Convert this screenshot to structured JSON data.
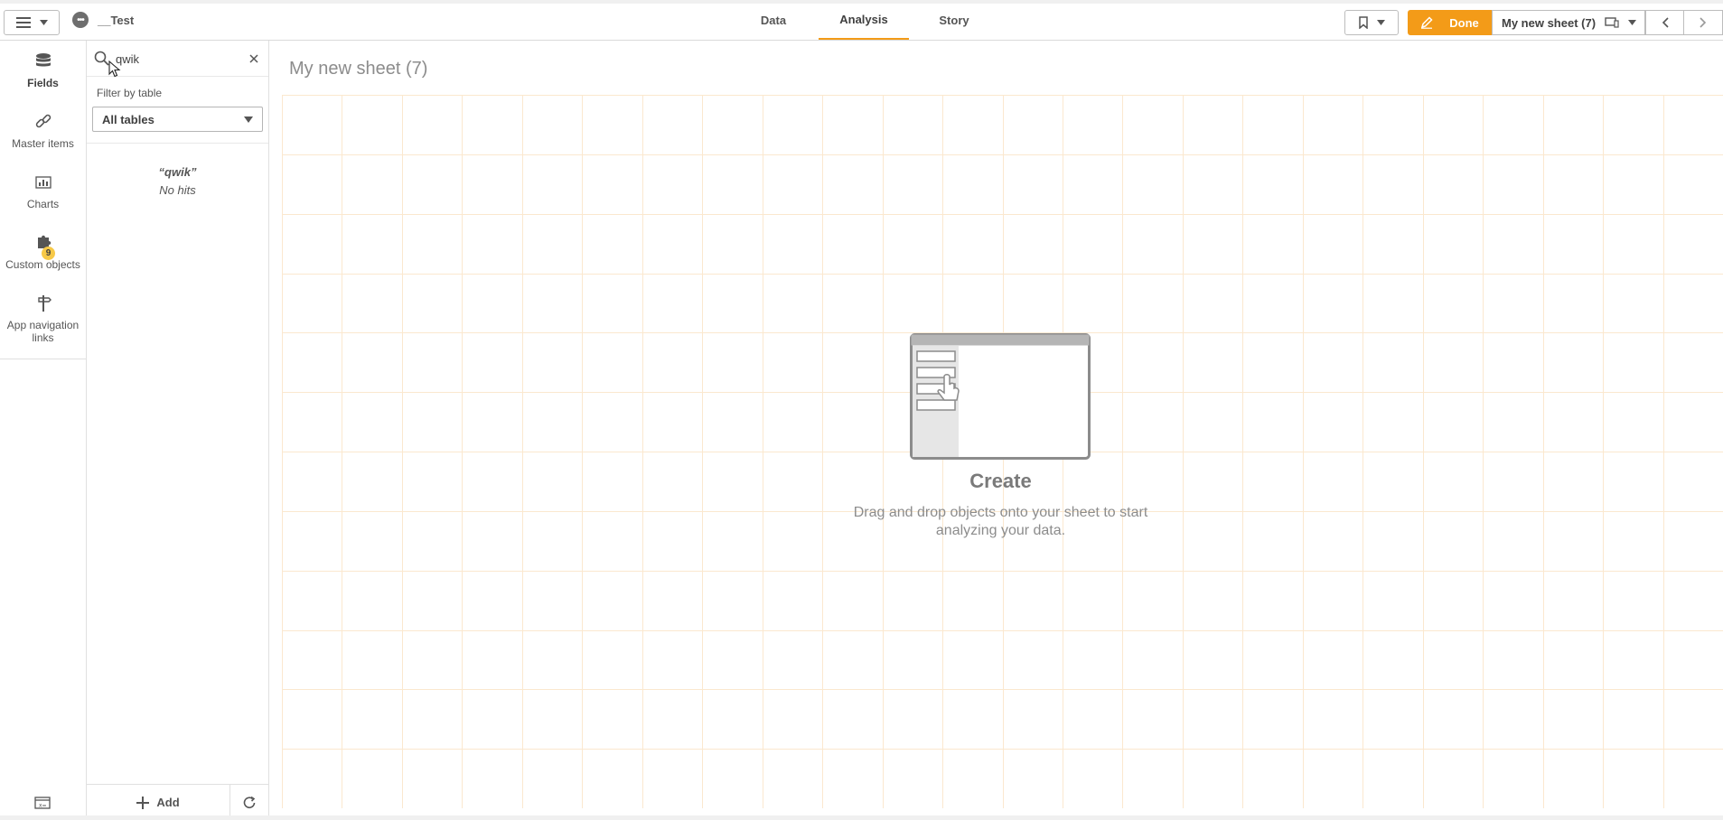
{
  "app": {
    "name": "__Test"
  },
  "tabs": [
    {
      "label": "Data",
      "active": false
    },
    {
      "label": "Analysis",
      "active": true
    },
    {
      "label": "Story",
      "active": false
    }
  ],
  "toolbar": {
    "done_label": "Done",
    "sheet_name": "My new sheet (7)"
  },
  "leftnav": {
    "items": [
      {
        "label": "Fields",
        "icon": "database-icon",
        "active": true
      },
      {
        "label": "Master items",
        "icon": "link-icon",
        "active": false
      },
      {
        "label": "Charts",
        "icon": "bar-chart-icon",
        "active": false
      },
      {
        "label": "Custom objects",
        "icon": "puzzle-icon",
        "active": false,
        "badge": "9"
      },
      {
        "label": "App navigation links",
        "icon": "signpost-icon",
        "active": false
      }
    ]
  },
  "fields_panel": {
    "search_value": "qwik",
    "filter_label": "Filter by table",
    "table_select": "All tables",
    "no_hits_term": "“qwik”",
    "no_hits_text": "No hits",
    "add_label": "Add"
  },
  "sheet": {
    "title": "My new sheet (7)",
    "create_title": "Create",
    "create_desc": "Drag and drop objects onto your sheet to start analyzing your data."
  },
  "colors": {
    "accent": "#f39b18",
    "grid": "#fbe8cf",
    "badge": "#f7c948"
  }
}
